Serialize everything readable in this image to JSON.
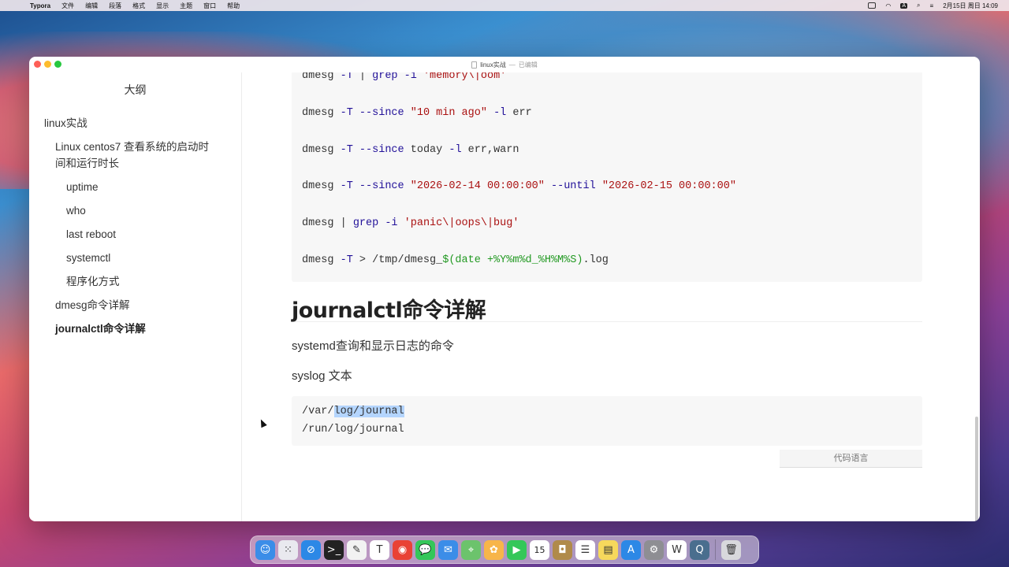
{
  "menubar": {
    "apple": "",
    "app_name": "Typora",
    "menus": [
      "文件",
      "编辑",
      "段落",
      "格式",
      "显示",
      "主题",
      "窗口",
      "帮助"
    ],
    "clock": "2月15日 周日  14:09",
    "input_source": "A"
  },
  "window": {
    "title": "linux实战",
    "status": "已编辑"
  },
  "sidebar": {
    "header": "大纲",
    "items": [
      {
        "label": "linux实战",
        "level": 1
      },
      {
        "label": "Linux centos7 查看系统的启动时间和运行时长",
        "level": 2
      },
      {
        "label": "uptime",
        "level": 3
      },
      {
        "label": "who",
        "level": 3
      },
      {
        "label": "last reboot",
        "level": 3
      },
      {
        "label": "systemctl",
        "level": 3
      },
      {
        "label": "程序化方式",
        "level": 3
      },
      {
        "label": "dmesg命令详解",
        "level": 2
      },
      {
        "label": "journalctl命令详解",
        "level": 2,
        "active": true
      }
    ]
  },
  "editor": {
    "code_block_1": [
      {
        "parts": [
          [
            "dmesg ",
            "p"
          ],
          [
            "-T",
            "k"
          ],
          [
            " | ",
            "p"
          ],
          [
            "grep",
            "k"
          ],
          [
            " ",
            "p"
          ],
          [
            "-i",
            "k"
          ],
          [
            " ",
            "p"
          ],
          [
            "'memory\\|oom'",
            "s"
          ]
        ]
      },
      {
        "parts": [
          [
            "dmesg ",
            "p"
          ],
          [
            "-T",
            "k"
          ],
          [
            " ",
            "p"
          ],
          [
            "--since",
            "k"
          ],
          [
            " ",
            "p"
          ],
          [
            "\"10 min ago\"",
            "s"
          ],
          [
            " ",
            "p"
          ],
          [
            "-l",
            "k"
          ],
          [
            " err",
            "p"
          ]
        ]
      },
      {
        "parts": [
          [
            "dmesg ",
            "p"
          ],
          [
            "-T",
            "k"
          ],
          [
            " ",
            "p"
          ],
          [
            "--since",
            "k"
          ],
          [
            " today ",
            "p"
          ],
          [
            "-l",
            "k"
          ],
          [
            " err,warn",
            "p"
          ]
        ]
      },
      {
        "parts": [
          [
            "dmesg ",
            "p"
          ],
          [
            "-T",
            "k"
          ],
          [
            " ",
            "p"
          ],
          [
            "--since",
            "k"
          ],
          [
            " ",
            "p"
          ],
          [
            "\"2026-02-14 00:00:00\"",
            "s"
          ],
          [
            " ",
            "p"
          ],
          [
            "--until",
            "k"
          ],
          [
            " ",
            "p"
          ],
          [
            "\"2026-02-15 00:00:00\"",
            "s"
          ]
        ]
      },
      {
        "parts": [
          [
            "dmesg | ",
            "p"
          ],
          [
            "grep",
            "k"
          ],
          [
            " ",
            "p"
          ],
          [
            "-i",
            "k"
          ],
          [
            " ",
            "p"
          ],
          [
            "'panic\\|oops\\|bug'",
            "s"
          ]
        ]
      },
      {
        "parts": [
          [
            "dmesg ",
            "p"
          ],
          [
            "-T",
            "k"
          ],
          [
            " > /tmp/dmesg_",
            "p"
          ],
          [
            "$(date +%Y%m%d_%H%M%S)",
            "v"
          ],
          [
            ".log",
            "p"
          ]
        ]
      }
    ],
    "heading": "journalctl命令详解",
    "para1": "systemd查询和显示日志的命令",
    "para2": "syslog 文本",
    "code_block_2": {
      "line1_prefix": "/var/",
      "line1_selected": "log/journal",
      "line2": "/run/log/journal"
    },
    "code_language_placeholder": "代码语言"
  },
  "dock": {
    "apps": [
      {
        "name": "finder-icon",
        "color": "#3b8de8",
        "glyph": "☺"
      },
      {
        "name": "launchpad-icon",
        "color": "#e9e9ef",
        "glyph": "⁙"
      },
      {
        "name": "safari-icon",
        "color": "#2c88e6",
        "glyph": "⊘"
      },
      {
        "name": "terminal-icon",
        "color": "#222222",
        "glyph": ">_"
      },
      {
        "name": "textedit-icon",
        "color": "#f2f2f2",
        "glyph": "✎"
      },
      {
        "name": "typora-icon",
        "color": "#ffffff",
        "glyph": "T"
      },
      {
        "name": "chrome-icon",
        "color": "#e94235",
        "glyph": "◉"
      },
      {
        "name": "messages-icon",
        "color": "#34c759",
        "glyph": "💬"
      },
      {
        "name": "mail-icon",
        "color": "#3b8de8",
        "glyph": "✉"
      },
      {
        "name": "maps-icon",
        "color": "#6cc36c",
        "glyph": "⌖"
      },
      {
        "name": "photos-icon",
        "color": "#f7b54a",
        "glyph": "✿"
      },
      {
        "name": "facetime-icon",
        "color": "#34c759",
        "glyph": "▶"
      },
      {
        "name": "calendar-icon",
        "color": "#ffffff",
        "glyph": "15"
      },
      {
        "name": "notes-brown-icon",
        "color": "#b08a4a",
        "glyph": "◘"
      },
      {
        "name": "reminders-icon",
        "color": "#ffffff",
        "glyph": "☰"
      },
      {
        "name": "notes-icon",
        "color": "#f6d85c",
        "glyph": "▤"
      },
      {
        "name": "appstore-icon",
        "color": "#2c88e6",
        "glyph": "A"
      },
      {
        "name": "settings-icon",
        "color": "#8e8e93",
        "glyph": "⚙"
      },
      {
        "name": "wps-icon",
        "color": "#ffffff",
        "glyph": "W"
      },
      {
        "name": "quicktime-icon",
        "color": "#4a6e8e",
        "glyph": "Q"
      },
      {
        "name": "trash-icon",
        "color": "#d8d8dc",
        "glyph": "🗑"
      }
    ]
  }
}
